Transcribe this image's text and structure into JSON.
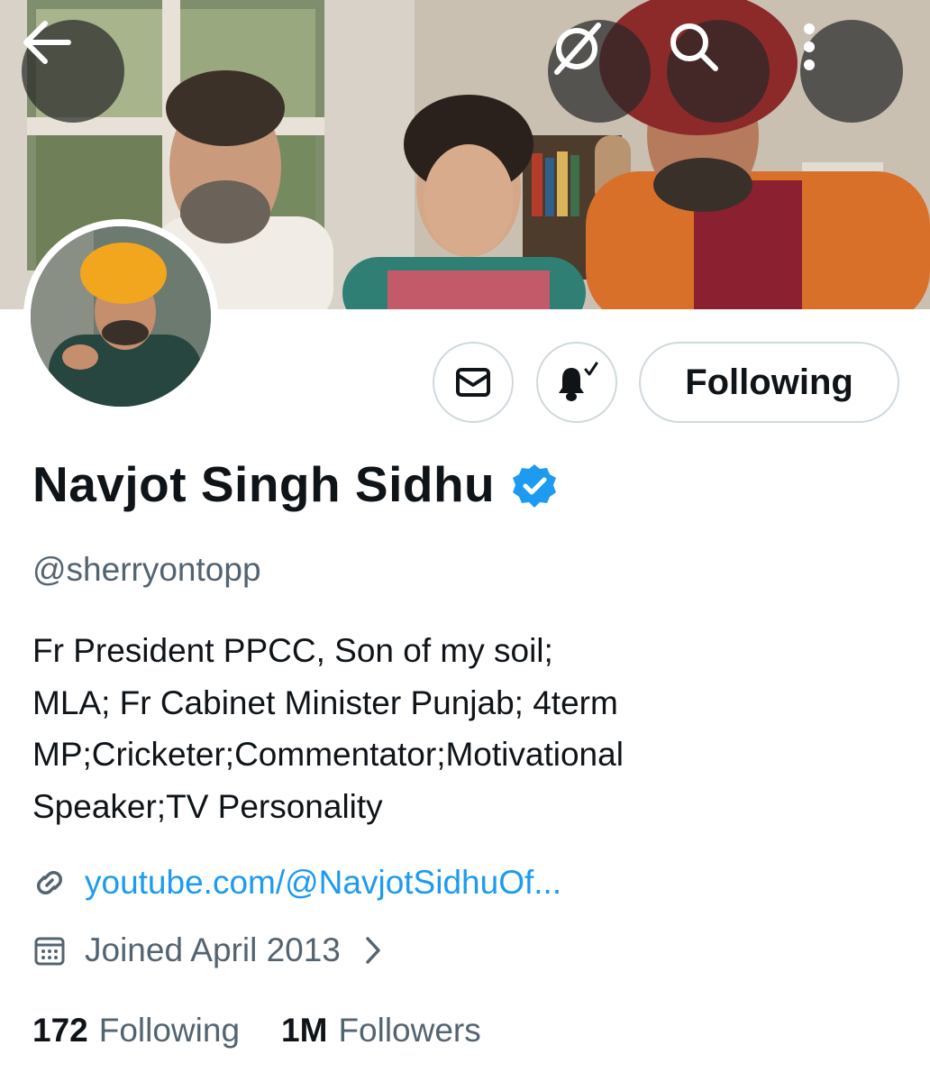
{
  "header": {
    "back_icon": "arrow-left-icon",
    "grok_icon": "grok-slash-icon",
    "search_icon": "search-icon",
    "more_icon": "more-vertical-icon"
  },
  "profile": {
    "name": "Navjot Singh Sidhu",
    "verified": true,
    "handle": "@sherryontopp",
    "bio_lines": [
      "Fr President PPCC, Son of my soil;",
      "MLA; Fr Cabinet Minister Punjab; 4term",
      "MP;Cricketer;Commentator;Motivational",
      "Speaker;TV Personality"
    ],
    "link": "youtube.com/@NavjotSidhuOf...",
    "joined": "Joined April 2013"
  },
  "actions": {
    "following_label": "Following",
    "message_icon": "envelope-icon",
    "notify_icon": "bell-check-icon"
  },
  "stats": {
    "following_count": "172",
    "following_label": "Following",
    "followers_count": "1M",
    "followers_label": "Followers"
  },
  "colors": {
    "accent": "#1d9bf0",
    "text_primary": "#0f1419",
    "text_secondary": "#536471",
    "border": "#cfd9de"
  }
}
